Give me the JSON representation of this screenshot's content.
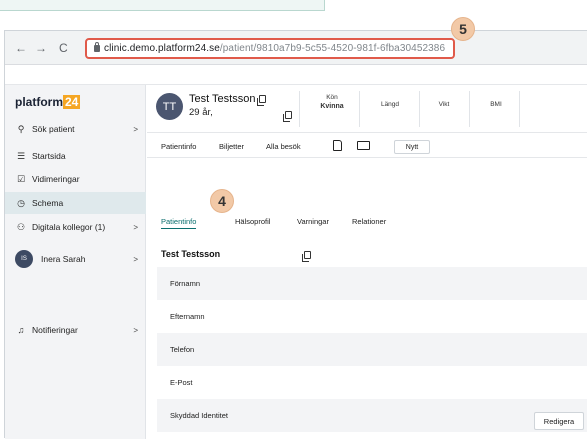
{
  "browser": {
    "back": "←",
    "forward": "→",
    "reload": "C",
    "url_host": "clinic.demo.platform24.se",
    "url_path": "/patient/9810a7b9-5c55-4520-981f-6fba30452386"
  },
  "annotations": {
    "badge_5": "5",
    "badge_4": "4"
  },
  "sidebar": {
    "logo_text": "platform",
    "logo_num": "24",
    "items": [
      {
        "label": "Sök patient",
        "icon": "search-icon",
        "glyph": "⚲",
        "chev": ">"
      },
      {
        "label": "Startsida",
        "icon": "list-icon",
        "glyph": "☰"
      },
      {
        "label": "Vidimeringar",
        "icon": "checkbox-icon",
        "glyph": "☑"
      },
      {
        "label": "Schema",
        "icon": "clock-icon",
        "glyph": "◷"
      },
      {
        "label": "Digitala kollegor (1)",
        "icon": "people-icon",
        "glyph": "⚇",
        "chev": ">"
      },
      {
        "label": "Inera Sarah",
        "avatar": "IS",
        "chev": ">"
      },
      {
        "label": "Notifieringar",
        "icon": "bell-icon",
        "glyph": "♫",
        "chev": ">"
      }
    ]
  },
  "patient": {
    "initials": "TT",
    "name": "Test Testsson",
    "age": "29 år,",
    "stats": [
      {
        "label": "Kön",
        "value": "Kvinna"
      },
      {
        "label": "Längd",
        "value": ""
      },
      {
        "label": "Vikt",
        "value": ""
      },
      {
        "label": "BMI",
        "value": ""
      }
    ]
  },
  "tabs_top": [
    "Patientinfo",
    "Biljetter",
    "Alla besök"
  ],
  "nytt_label": "Nytt",
  "tabs_sub": [
    "Patientinfo",
    "Hälsoprofil",
    "Varningar",
    "Relationer"
  ],
  "section": {
    "title": "Test Testsson",
    "fields": [
      "Förnamn",
      "Efternamn",
      "Telefon",
      "E-Post",
      "Skyddad Identitet"
    ]
  },
  "edit_label": "Redigera",
  "colors": {
    "accent": "#0b6e6e",
    "highlight": "#e05a4a",
    "badge": "#f2c9a7",
    "logo": "#f5a623"
  }
}
